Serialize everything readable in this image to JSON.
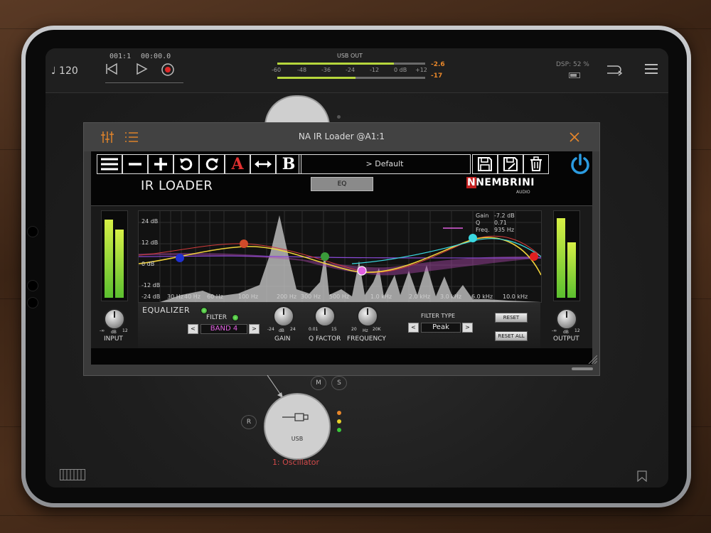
{
  "topbar": {
    "tempo": "♩ 120",
    "position_bars": "001:1",
    "position_time": "00:00.0",
    "meter_title": "USB OUT",
    "meter_scale": [
      "-60",
      "-48",
      "-36",
      "-24",
      "-12",
      "0 dB",
      "+12"
    ],
    "peak_top": "-2.6",
    "peak_bottom": "-17",
    "dsp": "DSP: 52 %"
  },
  "plugin": {
    "title": "NA IR Loader @A1:1",
    "preset": "> Default",
    "product": "IR LOADER",
    "eq_button": "EQ",
    "brand": "NEMBRINI",
    "brand_sub": "AUDIO",
    "graph": {
      "db_labels": [
        "24 dB",
        "12 dB",
        "0 dB",
        "-12 dB",
        "-24 dB"
      ],
      "freq_labels": [
        "30 Hz",
        "40 Hz",
        "60 Hz",
        "100 Hz",
        "200 Hz",
        "300 Hz",
        "500 Hz",
        "1.0 kHz",
        "2.0 kHz",
        "3.0 kHz",
        "6.0 kHz",
        "10.0 kHz"
      ],
      "info_gain_label": "Gain",
      "info_gain_value": "-7.2 dB",
      "info_q_label": "Q",
      "info_q_value": "0.71",
      "info_freq_label": "Freq.",
      "info_freq_value": "935 Hz"
    },
    "controls": {
      "equalizer": "EQUALIZER",
      "filter": "FILTER",
      "band": "BAND 4",
      "gain": "GAIN",
      "gain_min": "-24",
      "gain_unit": "dB",
      "gain_max": "24",
      "q_factor": "Q FACTOR",
      "q_min": "0.01",
      "q_max": "15",
      "frequency": "FREQUENCY",
      "freq_min": "20",
      "freq_unit": "Hz",
      "freq_max": "20K",
      "filter_type": "FILTER TYPE",
      "filter_type_value": "Peak",
      "reset": "RESET",
      "reset_all": "RESET ALL",
      "input": "INPUT",
      "output": "OUTPUT",
      "in_min": "-∞",
      "in_unit": "dB",
      "in_max": "12"
    }
  },
  "nodes": {
    "m": "M",
    "s": "S",
    "r": "R",
    "usb": "USB",
    "label": "1: Oscillator"
  },
  "colors": {
    "accent_orange": "#e8872a",
    "node_label_red": "#d14a4a",
    "power_blue": "#2b9be0",
    "band_pink": "#e060e0"
  }
}
